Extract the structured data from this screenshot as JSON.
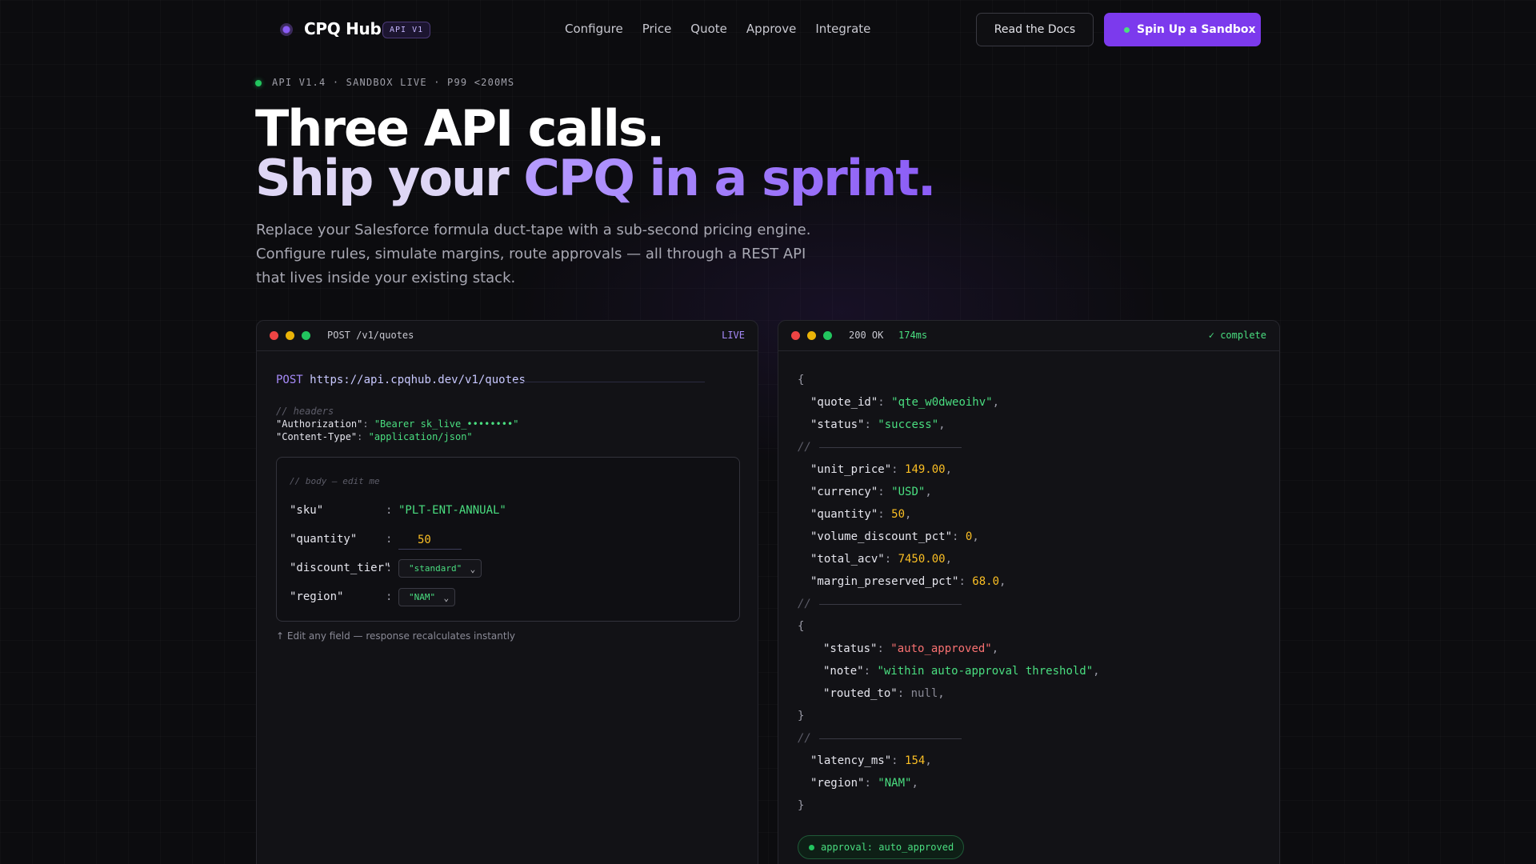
{
  "nav": {
    "logo": "CPQ Hub",
    "badge": "API V1",
    "links": [
      "Configure",
      "Price",
      "Quote",
      "Approve",
      "Integrate"
    ],
    "docs_button": "Read the Docs",
    "sandbox_button": "Spin Up a Sandbox"
  },
  "hero": {
    "status": "API V1.4 · SANDBOX LIVE · P99 <200MS",
    "headline_1": "Three API calls.",
    "headline_2_lead": "Ship your ",
    "headline_2_accent": "CPQ in a sprint.",
    "subtitle": "Replace your Salesforce formula duct-tape with a sub-second pricing engine. Configure rules, simulate margins, route approvals — all through a REST API that lives inside your existing stack."
  },
  "request_panel": {
    "title": "POST /v1/quotes",
    "live": "LIVE",
    "method": "POST",
    "url": "https://api.cpqhub.dev/v1/quotes",
    "headers_comment": "// headers",
    "auth_key": "\"Authorization\"",
    "auth_value": "\"Bearer sk_live_••••••••\"",
    "ctype_key": "\"Content-Type\"",
    "ctype_value": "\"application/json\"",
    "body_comment": "// body — edit me",
    "fields": {
      "sku_key": "\"sku\"",
      "sku_value": "\"PLT-ENT-ANNUAL\"",
      "quantity_key": "\"quantity\"",
      "quantity_value": "50",
      "discount_key": "\"discount_tier\"",
      "discount_value": "\"standard\"",
      "region_key": "\"region\"",
      "region_value": "\"NAM\""
    },
    "hint": "↑ Edit any field — response recalculates instantly"
  },
  "response_panel": {
    "status": "200 OK",
    "time": "174ms",
    "complete": "✓ complete",
    "quote_id": "\"qte_w0dweoihv\"",
    "status_value": "\"success\"",
    "unit_price": "149.00",
    "currency": "\"USD\"",
    "quantity": "50",
    "volume_discount_pct": "0",
    "total_acv": "7450.00",
    "margin_preserved_pct": "68.0",
    "approval_status": "\"auto_approved\"",
    "approval_note": "\"within auto-approval threshold\"",
    "routed_to": "null",
    "latency_ms": "154",
    "region": "\"NAM\"",
    "pill": "approval: auto_approved"
  }
}
